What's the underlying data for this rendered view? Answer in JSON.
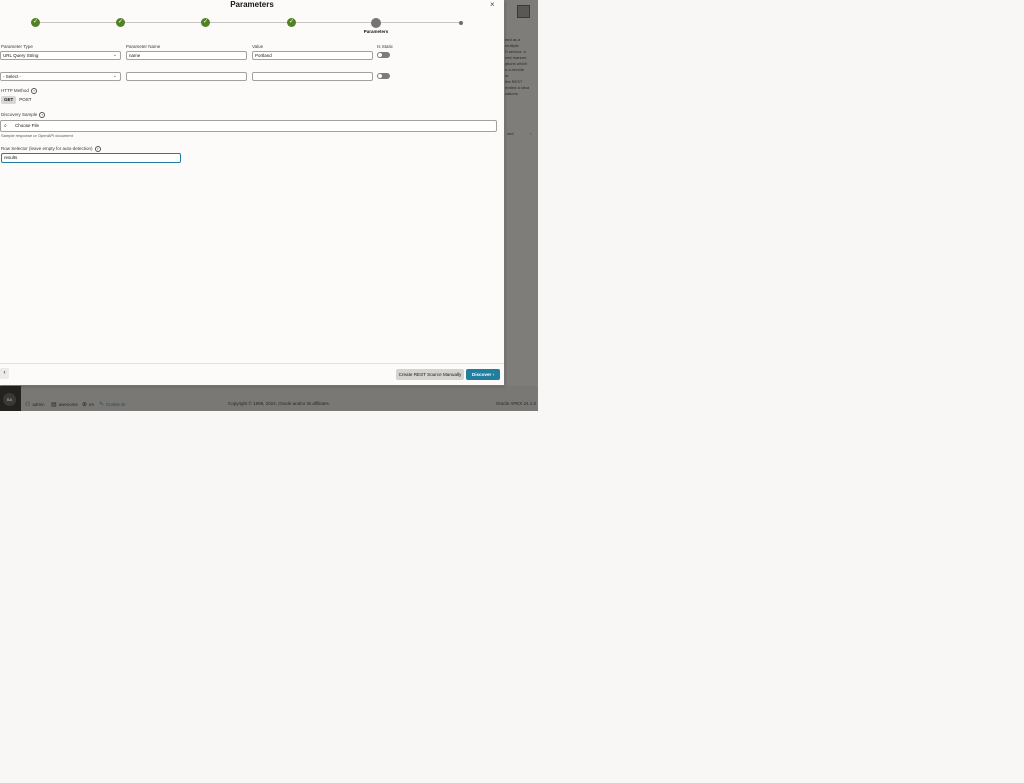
{
  "dialog": {
    "title": "Parameters",
    "close_icon": "close-icon",
    "steps": [
      {
        "state": "done",
        "icon": "check-icon"
      },
      {
        "state": "done",
        "icon": "check-icon"
      },
      {
        "state": "done",
        "icon": "check-icon"
      },
      {
        "state": "done",
        "icon": "check-icon"
      },
      {
        "state": "current",
        "label": "Parameters"
      },
      {
        "state": "future"
      }
    ],
    "columns": {
      "type": "Parameter Type",
      "name": "Parameter Name",
      "value": "Value",
      "static": "Is Static"
    },
    "rows": [
      {
        "type": "URL Query String",
        "name": "name",
        "value": "Portland",
        "is_static": false
      },
      {
        "type": "- Select -",
        "name": "",
        "value": "",
        "is_static": false
      }
    ],
    "http_method": {
      "label": "HTTP Method",
      "options": [
        "GET",
        "POST"
      ],
      "selected": "GET"
    },
    "discovery_sample": {
      "label": "Discovery Sample",
      "button": "Choose File",
      "description": "Sample response or OpenAPI document"
    },
    "row_selector": {
      "label": "Row Selector (leave empty for auto-detection)",
      "value": "results"
    },
    "footer": {
      "back": "‹",
      "manual": "Create REST Source Manually",
      "discover": "Discover ›"
    },
    "accent_color": "#227e9e",
    "done_color": "#508223"
  },
  "background": {
    "side_text": [
      "eed as a",
      "multiple",
      "S service, a",
      "rest manner.",
      "ptions which",
      "o a remote",
      "in.",
      "the REST",
      "erated a circa",
      "cations."
    ],
    "side_text_b": "ved",
    "side_text_c": "›",
    "footer": {
      "avatar": "BA",
      "user": "admin",
      "workspace": "awesome",
      "language": "en",
      "builder": "Enable BI",
      "copyright": "Copyright © 1999, 2024, Oracle and/or its affiliates.",
      "version": "Oracle APEX 24.1.0"
    }
  }
}
